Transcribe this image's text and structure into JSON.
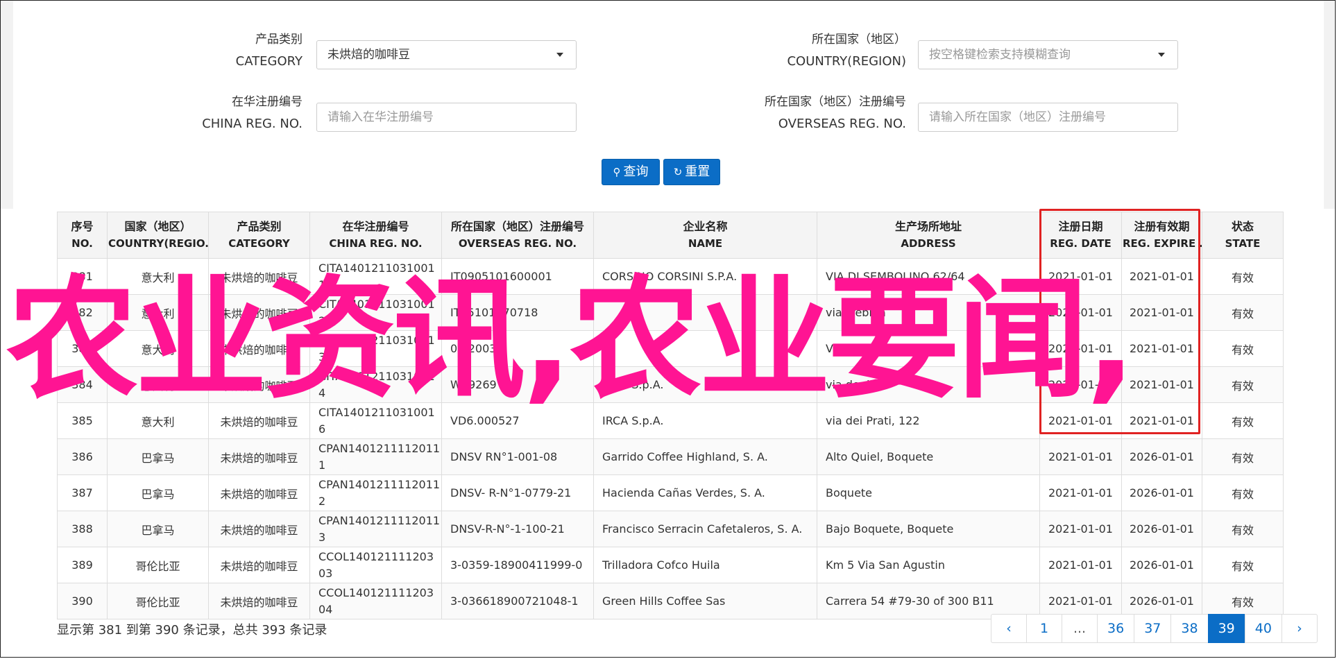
{
  "form": {
    "category": {
      "zh": "产品类别",
      "en": "CATEGORY",
      "value": "未烘焙的咖啡豆"
    },
    "country": {
      "zh": "所在国家（地区）",
      "en": "COUNTRY(REGION)",
      "placeholder": "按空格键检索支持模糊查询"
    },
    "china_reg": {
      "zh": "在华注册编号",
      "en": "CHINA REG. NO.",
      "placeholder": "请输入在华注册编号"
    },
    "overseas_reg": {
      "zh": "所在国家（地区）注册编号",
      "en": "OVERSEAS REG. NO.",
      "placeholder": "请输入所在国家（地区）注册编号"
    },
    "search_button": "查询",
    "reset_button": "重置"
  },
  "table": {
    "headers": [
      {
        "zh": "序号",
        "en": "NO."
      },
      {
        "zh": "国家（地区）",
        "en": "COUNTRY(REGIO..."
      },
      {
        "zh": "产品类别",
        "en": "CATEGORY"
      },
      {
        "zh": "在华注册编号",
        "en": "CHINA REG. NO."
      },
      {
        "zh": "所在国家（地区）注册编号",
        "en": "OVERSEAS REG. NO."
      },
      {
        "zh": "企业名称",
        "en": "NAME"
      },
      {
        "zh": "生产场所地址",
        "en": "ADDRESS"
      },
      {
        "zh": "注册日期",
        "en": "REG. DATE"
      },
      {
        "zh": "注册有效期",
        "en": "REG. EXPIRE ..."
      },
      {
        "zh": "状态",
        "en": "STATE"
      }
    ],
    "rows": [
      [
        "381",
        "意大利",
        "未烘焙的咖啡豆",
        "CITA14012110310011",
        "IT0905101600001",
        "CORSINO CORSINI S.P.A.",
        "VIA DI SEMBOLINO 62/64",
        "2021-01-01",
        "2021-01-01",
        "有效"
      ],
      [
        "382",
        "意大利",
        "未烘焙的咖啡豆",
        "CITA14012110310012",
        "IT25101170718",
        "",
        "via Trebbia",
        "2021-01-01",
        "2021-01-01",
        "有效"
      ],
      [
        "383",
        "意大利",
        "未烘焙的咖啡豆",
        "CITA14012110310013",
        "07/2003",
        "",
        "VIA SACCO",
        "2021-01-01",
        "2021-01-01",
        "有效"
      ],
      [
        "384",
        "意大利",
        "未烘焙的咖啡豆",
        "CITA14012110310014",
        "W69269",
        "IRCA S.p.A.",
        "via degli",
        "2021-01-01",
        "2021-01-01",
        "有效"
      ],
      [
        "385",
        "意大利",
        "未烘焙的咖啡豆",
        "CITA14012110310016",
        "VD6.000527",
        "IRCA S.p.A.",
        "via dei Prati, 122",
        "2021-01-01",
        "2021-01-01",
        "有效"
      ],
      [
        "386",
        "巴拿马",
        "未烘焙的咖啡豆",
        "CPAN14012111120111",
        "DNSV RN°1-001-08",
        "Garrido Coffee Highland, S. A.",
        "Alto Quiel, Boquete",
        "2021-01-01",
        "2026-01-01",
        "有效"
      ],
      [
        "387",
        "巴拿马",
        "未烘焙的咖啡豆",
        "CPAN14012111120112",
        "DNSV- R-N°1-0779-21",
        "Hacienda Cañas Verdes, S. A.",
        "Boquete",
        "2021-01-01",
        "2026-01-01",
        "有效"
      ],
      [
        "388",
        "巴拿马",
        "未烘焙的咖啡豆",
        "CPAN14012111120113",
        "DNSV-R-N°-1-100-21",
        "Francisco Serracin Cafetaleros, S. A.",
        "Bajo Boquete, Boquete",
        "2021-01-01",
        "2026-01-01",
        "有效"
      ],
      [
        "389",
        "哥伦比亚",
        "未烘焙的咖啡豆",
        "CCOL14012111120303",
        "3-0359-18900411999-0",
        "Trilladora Cofco Huila",
        "Km 5 Via San Agustin",
        "2021-01-01",
        "2026-01-01",
        "有效"
      ],
      [
        "390",
        "哥伦比亚",
        "未烘焙的咖啡豆",
        "CCOL14012111120304",
        "3-036618900721048-1",
        "Green Hills Coffee Sas",
        "Carrera 54 #79-30 of 300 B11",
        "2021-01-01",
        "2026-01-01",
        "有效"
      ]
    ]
  },
  "overlay": "农业资讯,农业要闻,",
  "footer": {
    "info": "显示第 381 到第 390 条记录，总共 393 条记录",
    "pages": [
      "‹",
      "1",
      "...",
      "36",
      "37",
      "38",
      "39",
      "40",
      "›"
    ],
    "active_page": "39"
  },
  "colors": {
    "accent": "#0b6dc6",
    "overlay": "#ff1493",
    "highlight_box": "#e02222"
  }
}
